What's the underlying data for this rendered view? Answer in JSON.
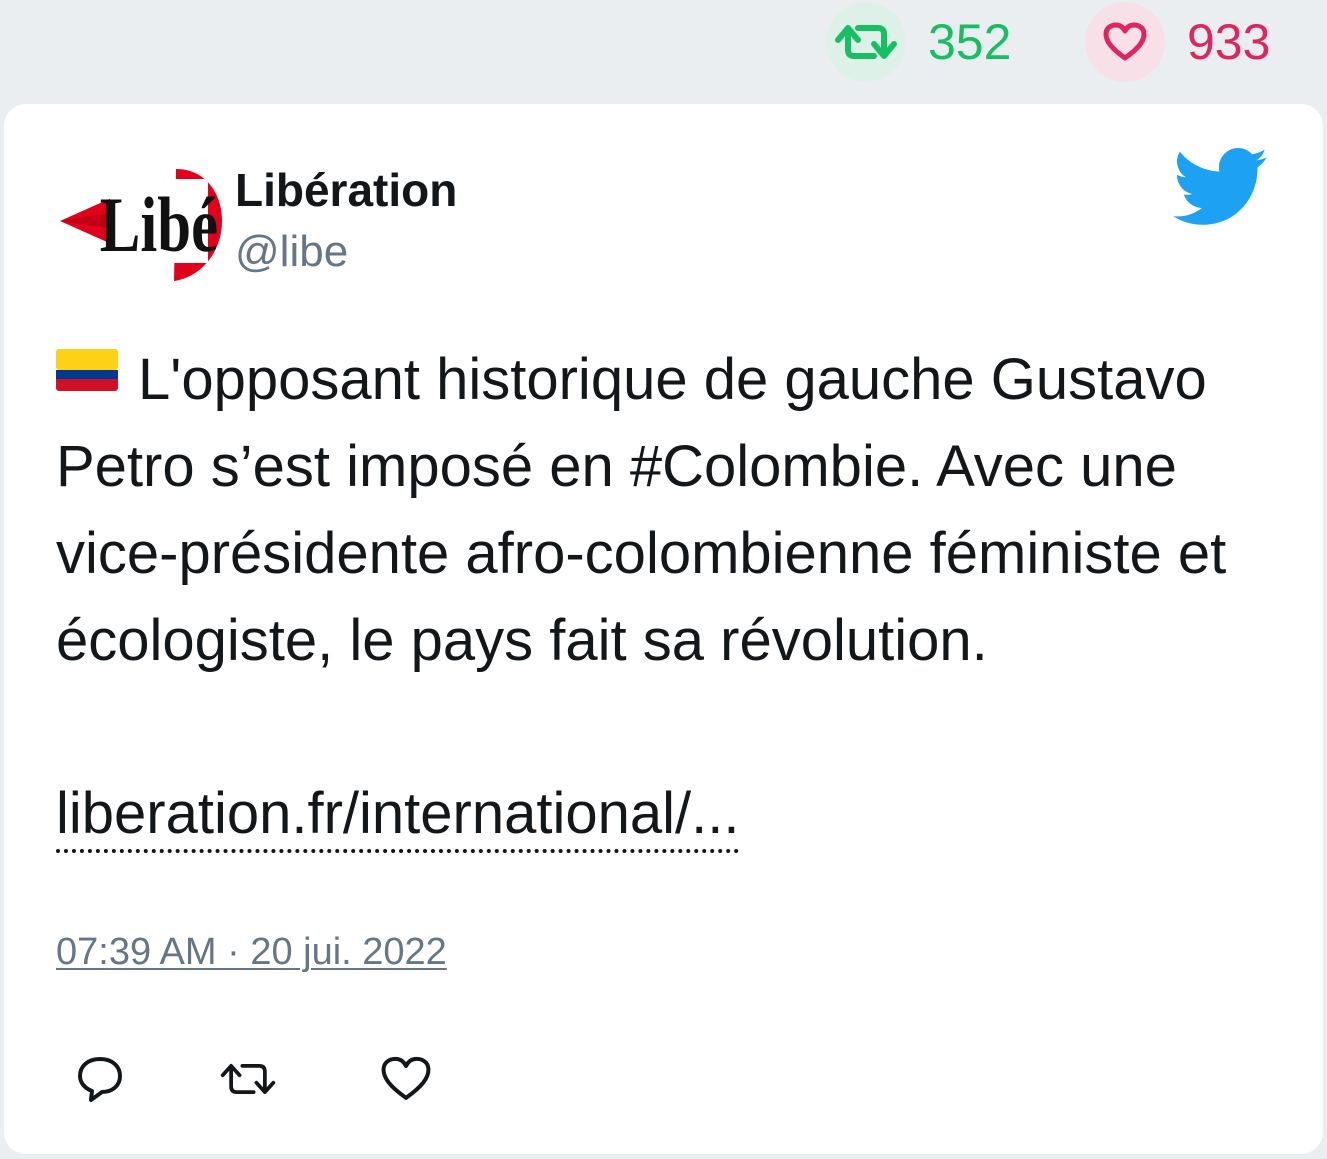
{
  "stats": {
    "retweet_count": "352",
    "like_count": "933",
    "retweet_color": "#17bf63",
    "like_color": "#e0245e"
  },
  "tweet": {
    "author_name": "Libération",
    "author_handle": "@libe",
    "avatar_logo_text": "Libé",
    "flag_icon": "colombia-flag-icon",
    "text": "L'opposant historique de gauche Gustavo Petro s’est imposé en #Colombie. Avec une vice-présidente afro-colombienne féministe et écologiste, le pays fait sa révolution.",
    "link": "liberation.fr/international/...",
    "timestamp": "07:39 AM · 20 jui. 2022"
  },
  "icons": {
    "brand": "twitter-bird-icon",
    "reply": "reply-icon",
    "retweet": "retweet-icon",
    "like": "heart-icon"
  },
  "colors": {
    "twitter_blue": "#1da1f2",
    "text": "#14171a",
    "muted": "#657786",
    "background": "#ebeef1"
  }
}
